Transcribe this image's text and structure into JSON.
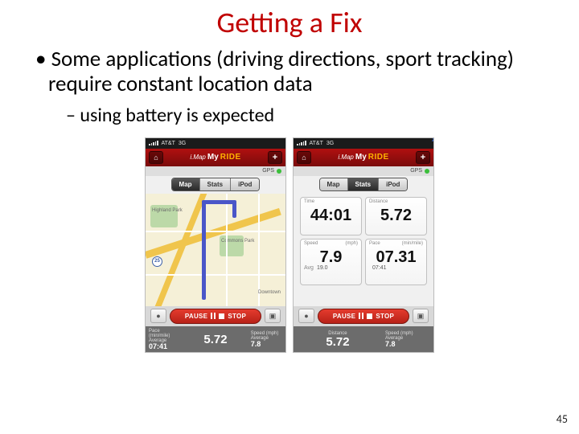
{
  "title": "Getting a Fix",
  "bullet": "Some applications (driving directions, sport tracking) require constant location data",
  "subbullet": "using battery is expected",
  "page_number": "45",
  "phone_common": {
    "carrier": "AT&T",
    "net": "3G",
    "app_imap": "i.Map",
    "app_my": "My",
    "app_ride": "RIDE",
    "home": "⌂",
    "plus": "+",
    "gps": "GPS",
    "close": "×",
    "tabs": {
      "map": "Map",
      "stats": "Stats",
      "ipod": "iPod"
    },
    "mic": "●",
    "cam": "▣",
    "pause": "PAUSE",
    "stop": "STOP"
  },
  "phone_map": {
    "labels": {
      "highland_park": "Highland\nPark",
      "commons_park": "Commons\nPark",
      "downtown": "Downtown",
      "shield": "25"
    },
    "footer": {
      "pace": {
        "label": "Pace (min/mile)",
        "avg_label": "Average",
        "avg": "07:41",
        "val_label": "",
        "val": ""
      },
      "dist": {
        "label": "Distance",
        "val": "5.72"
      },
      "speed": {
        "label": "Speed (mph)",
        "avg_label": "Average",
        "avg": "7.8",
        "val_label": "",
        "val": ""
      }
    }
  },
  "phone_stats": {
    "time": {
      "label": "Time",
      "val": "44:01"
    },
    "dist": {
      "label": "Distance",
      "val": "5.72"
    },
    "speed": {
      "label": "Speed",
      "unit": "(mph)",
      "val": "7.9",
      "avg_label": "Avg",
      "avg": "19.0"
    },
    "pace": {
      "label": "Pace",
      "unit": "(min/mile)",
      "val": "07.31",
      "avg_label": "",
      "avg": "07:41"
    },
    "footer": {
      "dist": {
        "label": "Distance",
        "val": "5.72"
      },
      "speed": {
        "label": "Speed (mph)",
        "avg_label": "Average",
        "avg": "7.8"
      }
    }
  }
}
